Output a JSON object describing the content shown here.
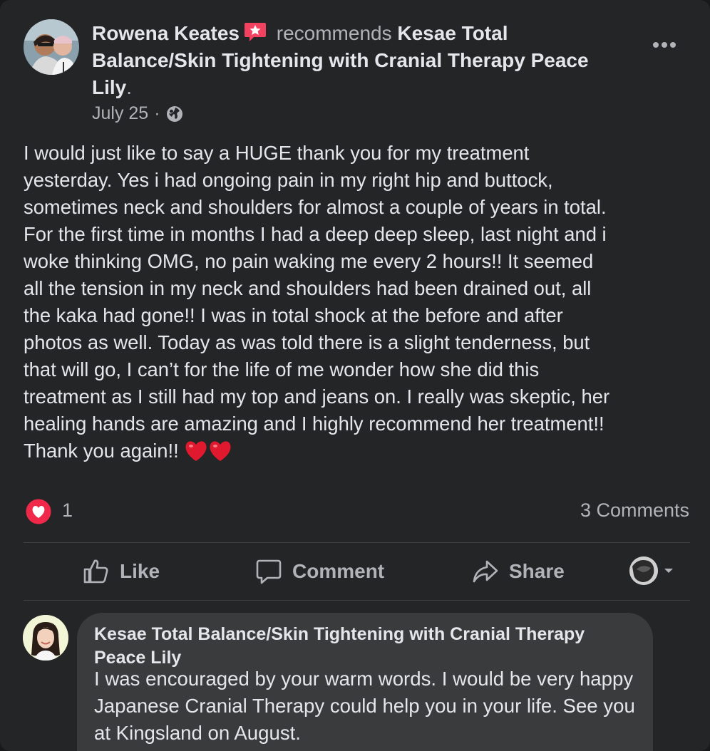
{
  "post": {
    "author": "Rowena Keates",
    "recommends_text": "recommends",
    "page_name": "Kesae Total Balance/Skin Tightening with Cranial Therapy Peace Lily",
    "date": "July 25",
    "separator": "·",
    "privacy_icon": "globe-icon",
    "body": "I would just like to say a HUGE thank you for my treatment\nyesterday.  Yes i had ongoing pain in my right hip and buttock,\nsometimes neck and shoulders for almost a couple of years in total.\nFor the first time in months I had a deep deep sleep, last night and i\nwoke thinking OMG, no pain waking me every 2 hours!!  It seemed\nall the tension in my neck and shoulders had been drained out, all\nthe kaka had gone!!  I was in total shock at the before and after\nphotos as well.  Today as was told there is a slight tenderness, but\nthat will go, I can’t for the life of me wonder how she did this\ntreatment as I still had my top and jeans on.  I really was skeptic, her\nhealing hands are amazing and I highly recommend her treatment!!\nThank you again!! "
  },
  "reactions": {
    "count": "1",
    "icon": "love-reaction-icon",
    "comments_label": "3 Comments"
  },
  "actions": {
    "like": "Like",
    "comment": "Comment",
    "share": "Share"
  },
  "comment": {
    "author": "Kesae Total Balance/Skin Tightening with Cranial Therapy Peace Lily",
    "text": "I was encouraged by your warm words. I would be very happy Japanese Cranial Therapy could help you in your life. See you at Kingsland on August."
  },
  "colors": {
    "background": "#242526",
    "text_primary": "#e4e6eb",
    "text_secondary": "#b0b3b8",
    "bubble": "#3a3b3c",
    "love_red": "#f02849",
    "recommend_red": "#f3425f"
  }
}
